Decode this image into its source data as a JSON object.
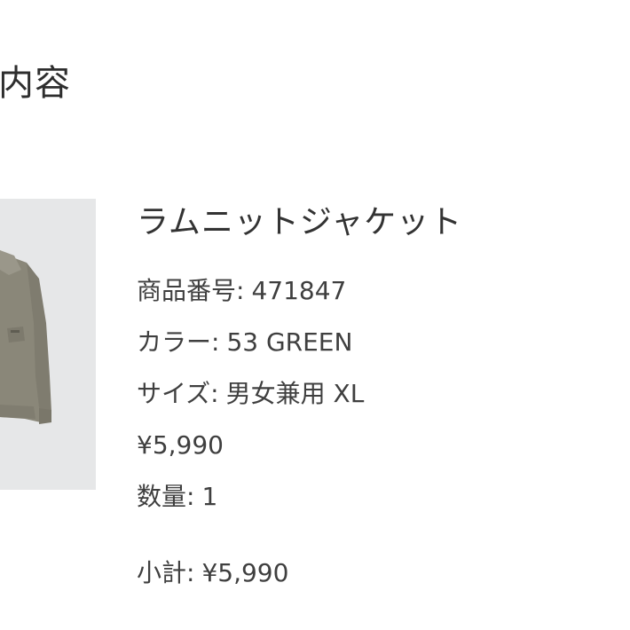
{
  "section": {
    "title": "内容"
  },
  "item": {
    "image_alt": "jacket-photo",
    "name": "ラムニットジャケット",
    "code_label": "商品番号:",
    "code_value": "471847",
    "color_label": "カラー:",
    "color_value": "53 GREEN",
    "size_label": "サイズ:",
    "size_value": "男女兼用 XL",
    "price": "¥5,990",
    "qty_label": "数量:",
    "qty_value": "1",
    "subtotal_label": "小計:",
    "subtotal_value": "¥5,990"
  },
  "colors": {
    "thumb_bg": "#e6e7e8",
    "jacket": "#8c8a7c",
    "text": "#3f3f3f"
  }
}
